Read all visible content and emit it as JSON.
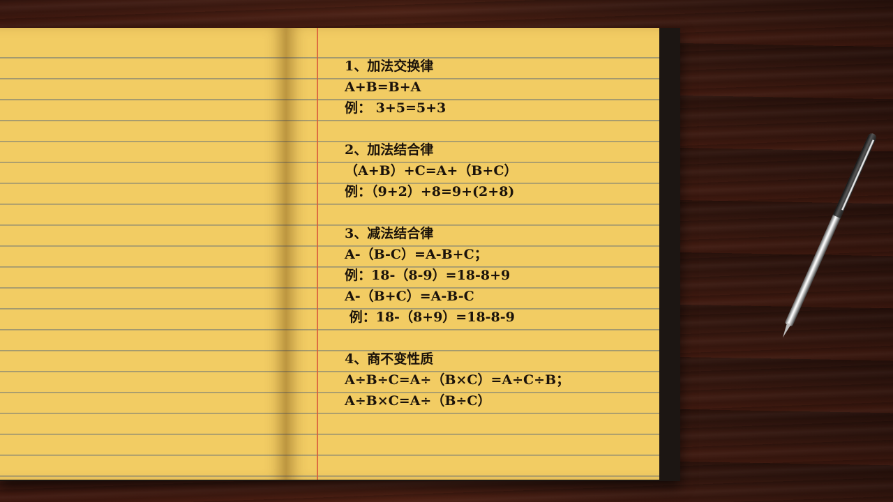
{
  "notes": {
    "s1_title": "1、加法交换律",
    "s1_formula": "A+B=B+A",
    "s1_example": "例： 3+5=5+3",
    "s2_title": "2、加法结合律",
    "s2_formula": "（A+B）+C=A+（B+C）",
    "s2_example": "例：（9+2）+8=9+(2+8)",
    "s3_title": "3、减法结合律",
    "s3_formula1": "A-（B-C）=A-B+C；",
    "s3_example1": "例：18-（8-9）=18-8+9",
    "s3_formula2": "A-（B+C）=A-B-C",
    "s3_example2": " 例：18-（8+9）=18-8-9",
    "s4_title": "4、商不变性质",
    "s4_formula1": "A÷B÷C=A÷（B×C）=A÷C÷B；",
    "s4_formula2": "A÷B×C=A÷（B÷C）"
  },
  "colors": {
    "paper": "#f2cc63",
    "ink": "#1a120a",
    "margin_line": "#d95a3a",
    "desk": "#3a1810"
  }
}
